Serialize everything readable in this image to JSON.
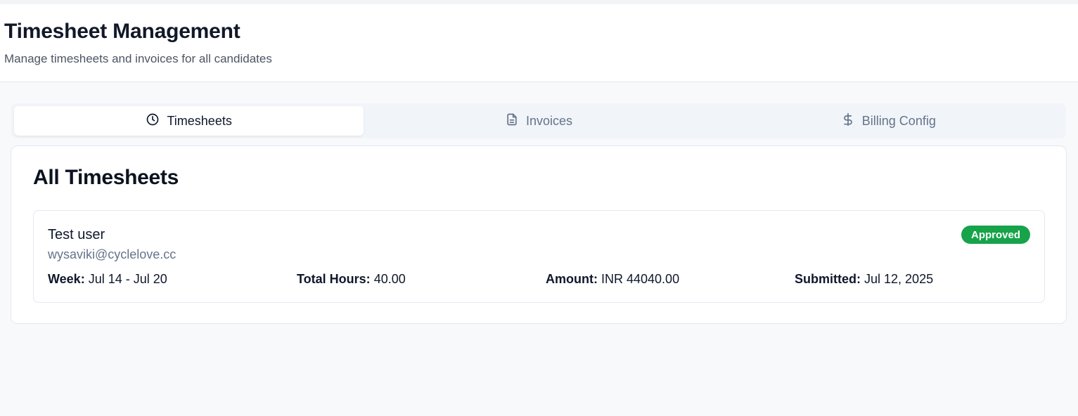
{
  "header": {
    "title": "Timesheet Management",
    "subtitle": "Manage timesheets and invoices for all candidates"
  },
  "tabs": [
    {
      "label": "Timesheets",
      "icon": "clock-icon",
      "active": true
    },
    {
      "label": "Invoices",
      "icon": "document-icon",
      "active": false
    },
    {
      "label": "Billing Config",
      "icon": "dollar-icon",
      "active": false
    }
  ],
  "section": {
    "title": "All Timesheets"
  },
  "timesheets": [
    {
      "name": "Test user",
      "email": "wysaviki@cyclelove.cc",
      "status": "Approved",
      "week_label": "Week:",
      "week": "Jul 14 - Jul 20",
      "hours_label": "Total Hours:",
      "hours": "40.00",
      "amount_label": "Amount:",
      "amount": "INR 44040.00",
      "submitted_label": "Submitted:",
      "submitted": "Jul 12, 2025"
    }
  ],
  "colors": {
    "approved": "#16a34a",
    "muted_text": "#64748b",
    "tabs_bg": "#f1f4f8"
  }
}
